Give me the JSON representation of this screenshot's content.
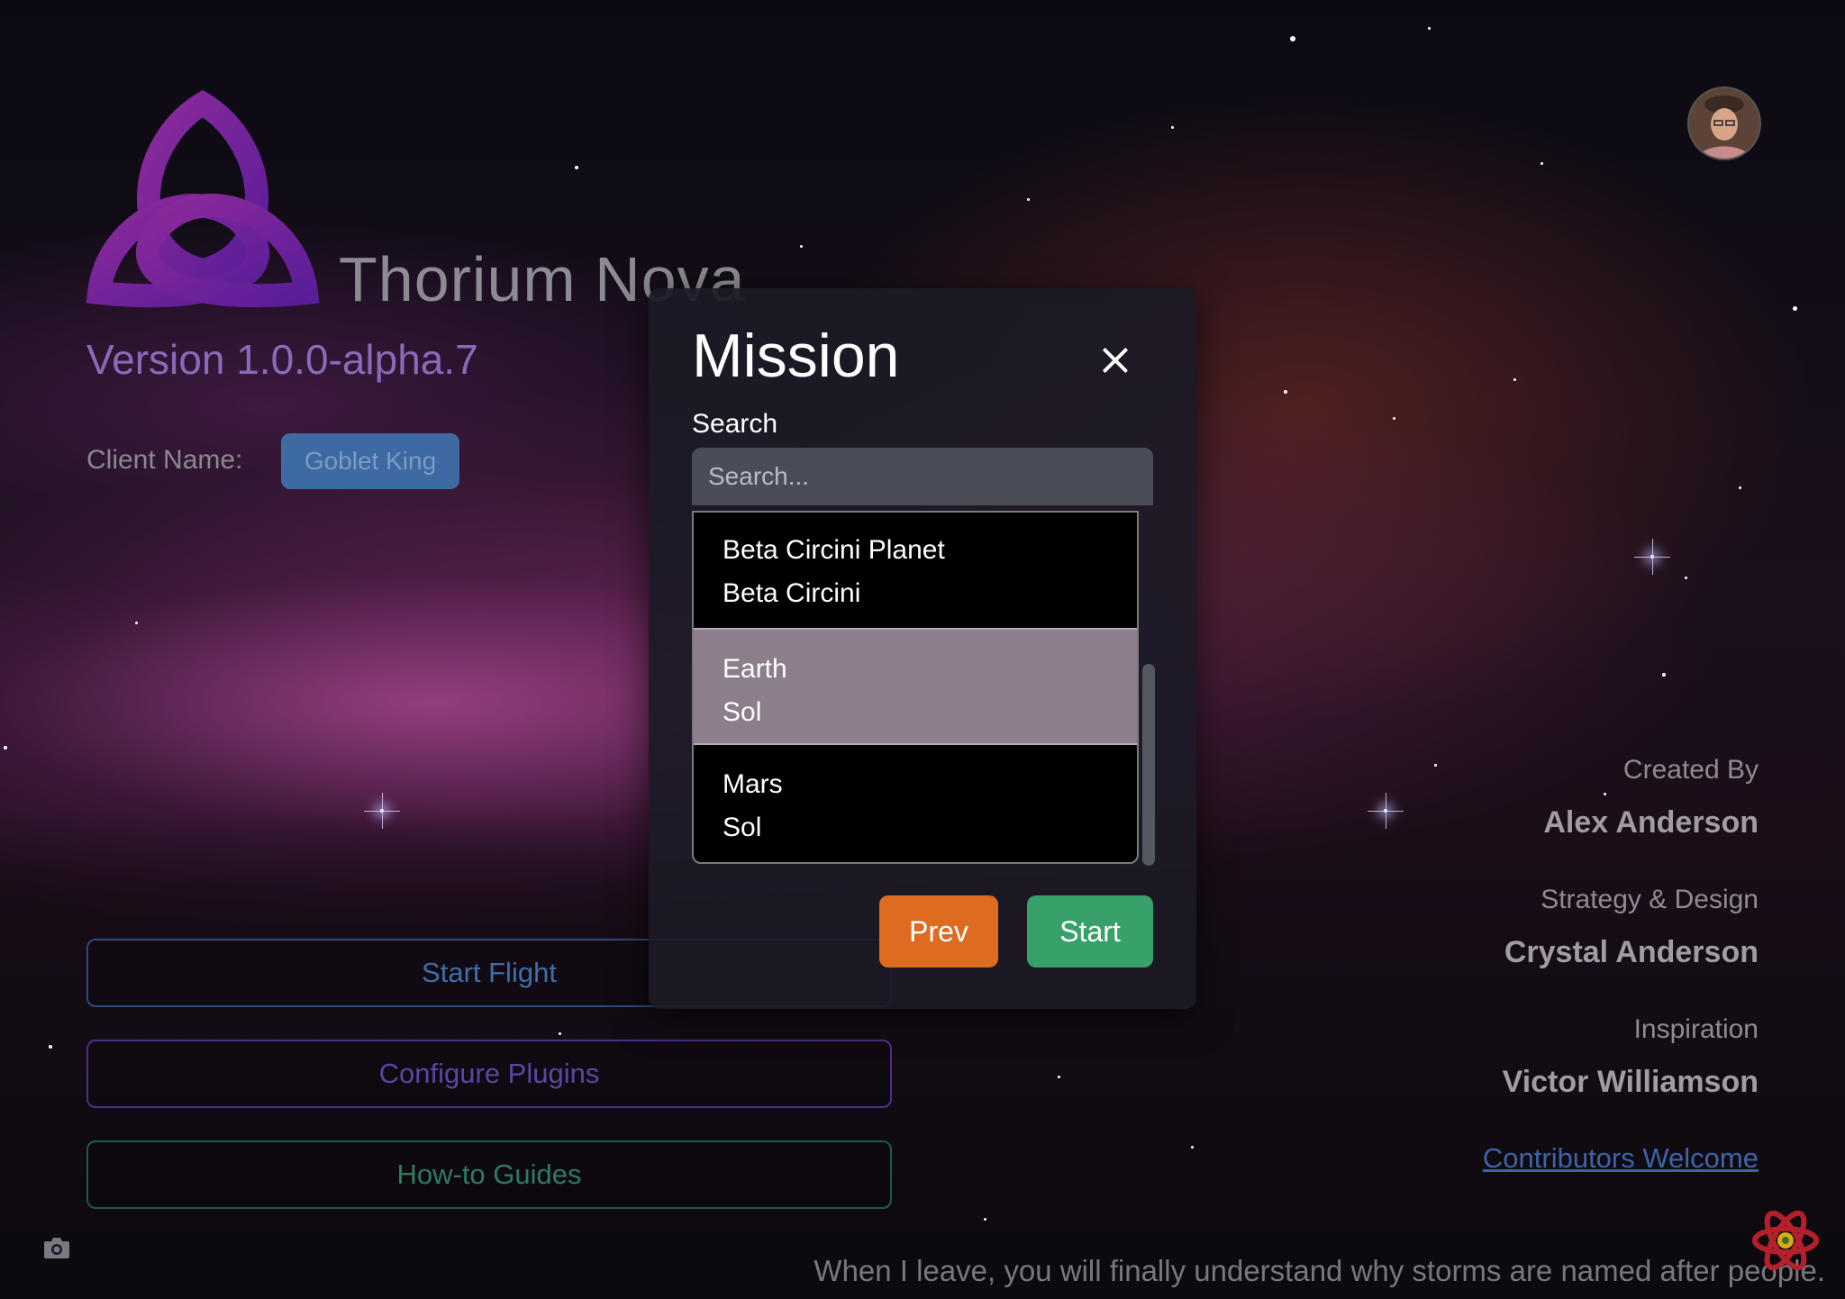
{
  "app": {
    "title": "Thorium Nova",
    "version": "Version 1.0.0-alpha.7"
  },
  "client": {
    "label": "Client Name:",
    "name": "Goblet King"
  },
  "menu": {
    "items": [
      {
        "label": "Start Flight"
      },
      {
        "label": "Configure Plugins"
      },
      {
        "label": "How-to Guides"
      }
    ]
  },
  "credits": [
    {
      "role": "Created By",
      "name": "Alex Anderson"
    },
    {
      "role": "Strategy & Design",
      "name": "Crystal Anderson"
    },
    {
      "role": "Inspiration",
      "name": "Victor Williamson"
    }
  ],
  "contributors_link": "Contributors Welcome",
  "quote": "When I leave, you will finally understand why storms are named after people.",
  "modal": {
    "title": "Mission",
    "search_label": "Search",
    "search_placeholder": "Search...",
    "search_value": "",
    "items": [
      {
        "name": "Beta Circini Planet",
        "system": "Beta Circini",
        "selected": false
      },
      {
        "name": "Earth",
        "system": "Sol",
        "selected": true
      },
      {
        "name": "Mars",
        "system": "Sol",
        "selected": false
      }
    ],
    "prev_label": "Prev",
    "start_label": "Start"
  },
  "icons": {
    "logo": "triquetra-logo",
    "close": "close-icon",
    "camera": "camera-icon",
    "atom": "atom-icon",
    "avatar": "user-avatar"
  },
  "colors": {
    "prev_button": "#dd6b20",
    "start_button": "#38a169",
    "client_button": "#3d6aa3",
    "selected_item": "#8d7e8b"
  }
}
